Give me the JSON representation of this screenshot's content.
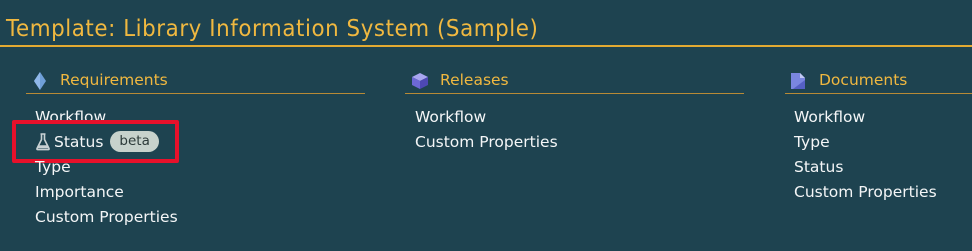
{
  "page": {
    "title": "Template: Library Information System (Sample)",
    "accent_color": "#f0b840",
    "background_color": "#1e4350",
    "highlight_color": "#e8112b"
  },
  "sections": {
    "requirements": {
      "label": "Requirements",
      "icon": "diamond-icon",
      "items": [
        {
          "label": "Workflow"
        },
        {
          "label": "Status",
          "badge": "beta",
          "icon": "flask-icon"
        },
        {
          "label": "Type"
        },
        {
          "label": "Importance"
        },
        {
          "label": "Custom Properties"
        }
      ]
    },
    "releases": {
      "label": "Releases",
      "icon": "cube-icon",
      "items": [
        {
          "label": "Workflow"
        },
        {
          "label": "Custom Properties"
        }
      ]
    },
    "documents": {
      "label": "Documents",
      "icon": "document-icon",
      "items": [
        {
          "label": "Workflow"
        },
        {
          "label": "Type"
        },
        {
          "label": "Status"
        },
        {
          "label": "Custom Properties"
        }
      ]
    }
  }
}
